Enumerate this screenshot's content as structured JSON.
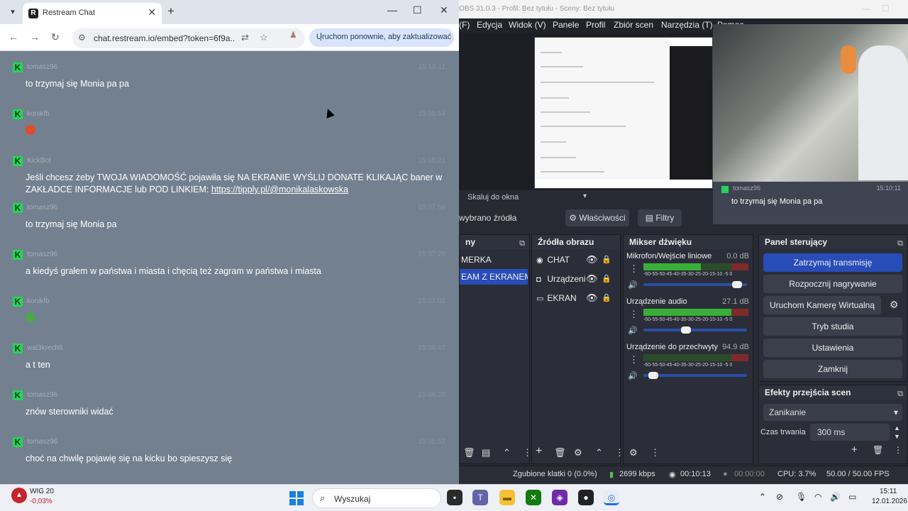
{
  "browser": {
    "tab_title": "Restream Chat",
    "tab_favicon": "R",
    "url": "chat.restream.io/embed?token=6f9a...",
    "update_prompt": "Uruchom ponownie, aby zaktualizować"
  },
  "chat": {
    "messages": [
      {
        "user": "tomasz96",
        "time": "15:10:11",
        "text": "to trzymaj się Monia pa pa"
      },
      {
        "user": "konikfb",
        "time": "15:09:54",
        "text": "",
        "emote_color": "#e14a2a"
      },
      {
        "user": "KickBot",
        "time": "15:08:21",
        "text": "Jeśli chcesz żeby TWOJA WIADOMOŚĆ pojawiła się NA EKRANIE WYŚLIJ DONATE KLIKAJĄC baner w ZAKŁADCE INFORMACJE lub POD LINKIEM: ",
        "link": "https://tipply.pl/@monikalaskowska"
      },
      {
        "user": "tomasz96",
        "time": "15:07:58",
        "text": "to trzymaj się Monia pa"
      },
      {
        "user": "tomasz96",
        "time": "15:07:26",
        "text": "a kiedyś grałem w państwa i miasta i chęcią też zagram w państwa i miasta"
      },
      {
        "user": "konikfb",
        "time": "15:07:02",
        "text": "",
        "emote_color": "#4aa84a"
      },
      {
        "user": "wal3krech6",
        "time": "15:06:47",
        "text": "a t ten"
      },
      {
        "user": "tomasz96",
        "time": "15:06:20",
        "text": "znów sterowniki widać"
      },
      {
        "user": "tomasz96",
        "time": "15:05:52",
        "text": "choć na chwilę pojawię się na kicku bo spieszysz się"
      }
    ]
  },
  "obs": {
    "title": "OBS 31.0.3 - Profil: Bez tytułu - Sceny: Bez tytułu",
    "menu": [
      "(F)",
      "Edycja",
      "Widok (V)",
      "Panele",
      "Profil",
      "Zbiór scen",
      "Narzędzia (T)",
      "Pomoc"
    ],
    "preview_overlay": {
      "user": "tomasz96",
      "time": "15:10:11",
      "text": "to trzymaj się Monia pa pa"
    },
    "scale_label": "Skaluj do okna",
    "no_source": "wybrano źródła",
    "properties_btn": "Właściwości",
    "filters_btn": "Filtry",
    "scenes": {
      "title": "ny",
      "items": [
        "MERKA",
        "EAM Z EKRANEM"
      ]
    },
    "sources": {
      "title": "Źródła obrazu",
      "items": [
        "CHAT",
        "Urządzeni",
        "EKRAN"
      ]
    },
    "mixer": {
      "title": "Mikser dźwięku",
      "channels": [
        {
          "name": "Mikrofon/Wejście liniowe",
          "db": "0.0 dB",
          "level": 0.55,
          "volume": 0.95
        },
        {
          "name": "Urządzenie audio",
          "db": "27.1 dB",
          "level": 0.85,
          "volume": 0.4
        },
        {
          "name": "Urządzenie do przechwyty",
          "db": "94.9 dB",
          "level": 0.0,
          "volume": 0.05
        }
      ],
      "scale": "-60-55-50-45-40-35-30-25-20-15-10 -5 0"
    },
    "controls": {
      "title": "Panel sterujący",
      "buttons": [
        "Zatrzymaj transmisję",
        "Rozpocznij nagrywanie",
        "Uruchom Kamerę Wirtualną",
        "Tryb studia",
        "Ustawienia",
        "Zamknij"
      ]
    },
    "transitions": {
      "title": "Efekty przejścia scen",
      "type": "Zanikanie",
      "duration_label": "Czas trwania",
      "duration": "300 ms"
    },
    "status": {
      "dropped": "Zgubione klatki 0 (0.0%)",
      "bitrate": "2699 kbps",
      "stream_time": "00:10:13",
      "rec_time": "00:00:00",
      "cpu": "CPU: 3.7%",
      "fps": "50.00 / 50.00 FPS"
    }
  },
  "taskbar": {
    "widget_name": "WIG 20",
    "widget_value": "-0,03%",
    "search_placeholder": "Wyszukaj",
    "time": "15:11",
    "date": "12.01.2026"
  }
}
